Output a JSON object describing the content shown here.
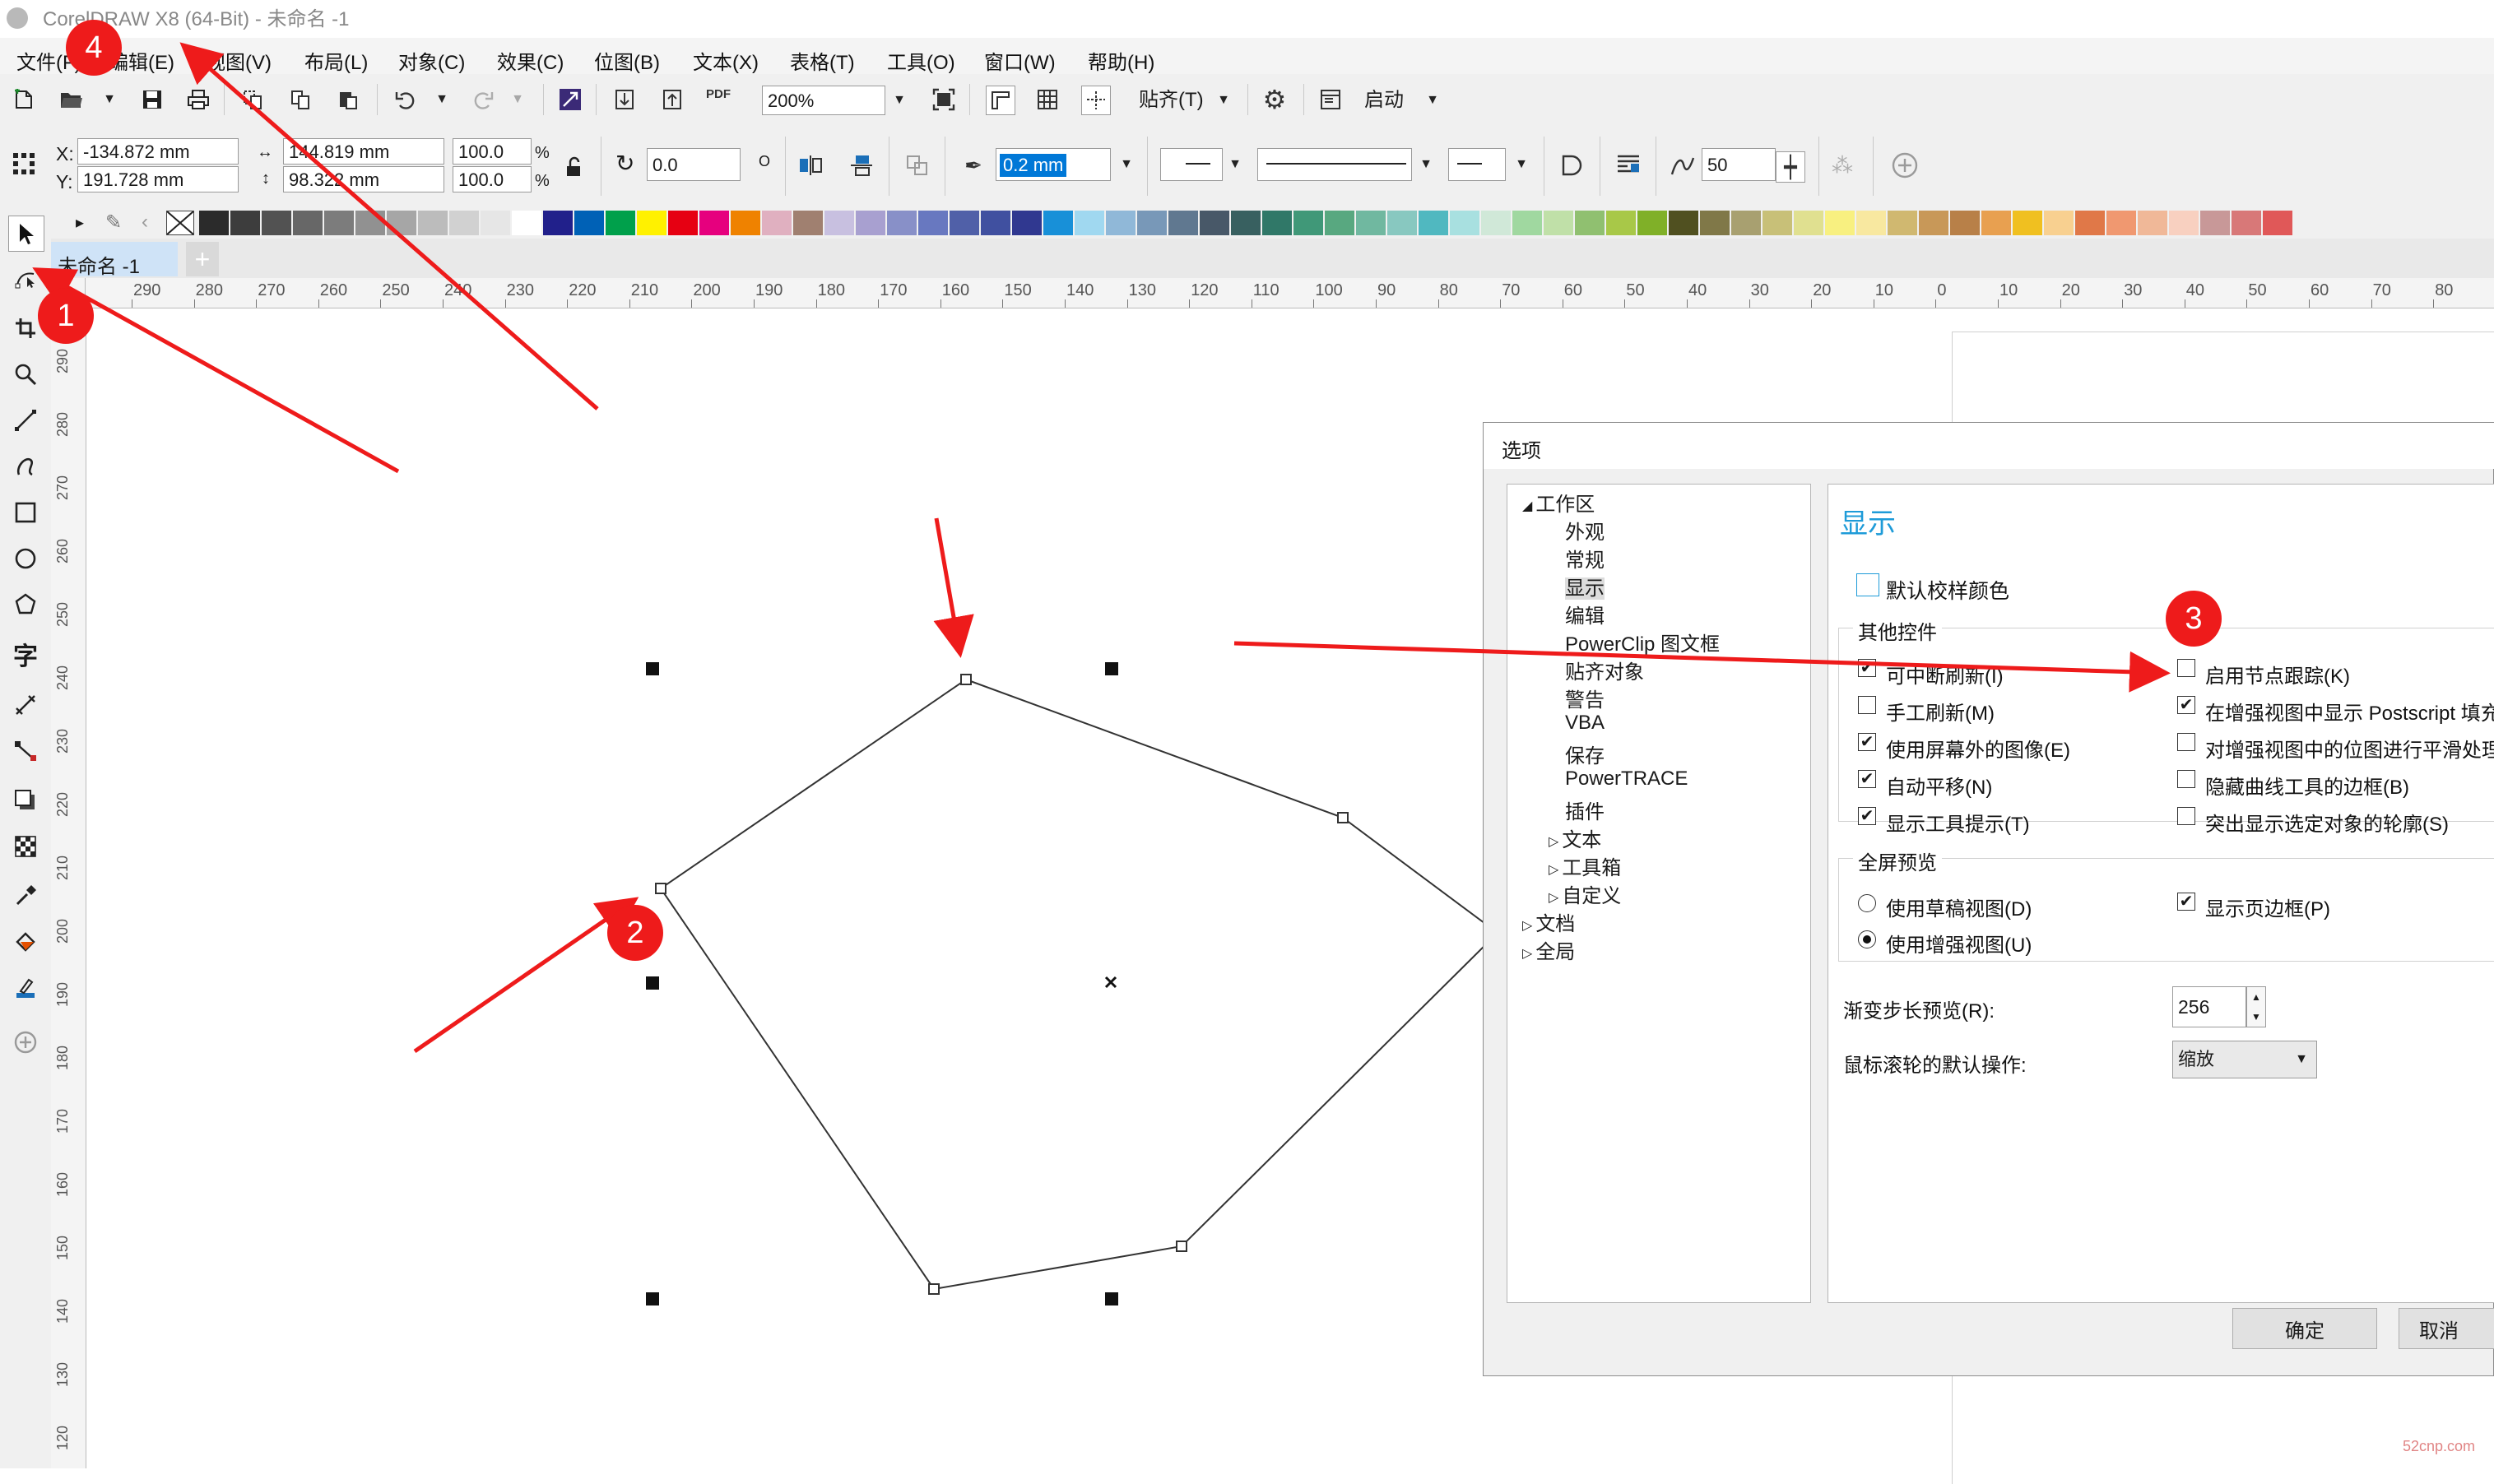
{
  "window": {
    "title": "CorelDRAW X8 (64-Bit) - 未命名 -1"
  },
  "menu": [
    "文件(F)",
    "编辑(E)",
    "视图(V)",
    "布局(L)",
    "对象(C)",
    "效果(C)",
    "位图(B)",
    "文本(X)",
    "表格(T)",
    "工具(O)",
    "窗口(W)",
    "帮助(H)"
  ],
  "toolbar": {
    "zoom": "200%",
    "snap_label": "贴齐(T)",
    "launch_label": "启动",
    "pdf_label": "PDF"
  },
  "properties": {
    "x_label": "X:",
    "x": "-134.872 mm",
    "y_label": "Y:",
    "y": "191.728 mm",
    "width": "144.819 mm",
    "height": "98.322 mm",
    "scale_w": "100.0",
    "scale_h": "100.0",
    "percent": "%",
    "rotation": "0.0",
    "degree": "O",
    "outline_width": "0.2 mm",
    "smoothing": "50"
  },
  "document_tab": "未命名 -1",
  "ruler": {
    "horizontal": [
      "290",
      "280",
      "270",
      "260",
      "250",
      "240",
      "230",
      "220",
      "210",
      "200",
      "190",
      "180",
      "170",
      "160",
      "150",
      "140",
      "130",
      "120",
      "110",
      "100",
      "90",
      "80",
      "70",
      "60",
      "50",
      "40",
      "30",
      "20",
      "10",
      "0",
      "10",
      "20",
      "30",
      "40",
      "50",
      "60",
      "70",
      "80"
    ],
    "vertical": [
      "290",
      "280",
      "270",
      "260",
      "250",
      "240",
      "230",
      "220",
      "210",
      "200",
      "190",
      "180",
      "170",
      "160",
      "150",
      "140",
      "130",
      "120"
    ]
  },
  "palette_colors": [
    "#2b2b2b",
    "#3d3d3d",
    "#525252",
    "#676767",
    "#7c7c7c",
    "#919191",
    "#a6a6a6",
    "#bcbcbc",
    "#d1d1d1",
    "#e6e6e6",
    "#ffffff",
    "#21208b",
    "#0061b6",
    "#00a04b",
    "#fff100",
    "#e60012",
    "#e6007e",
    "#ef8200",
    "#e0b0c0",
    "#a08070",
    "#c8c0e0",
    "#a8a0d0",
    "#8890c8",
    "#6878c0",
    "#5060a8",
    "#4050a0",
    "#303890",
    "#1890d8",
    "#a0d8f0",
    "#90b8d8",
    "#7898b8",
    "#607890",
    "#485868",
    "#386060",
    "#307868",
    "#409878",
    "#58a880",
    "#70b8a0",
    "#88c8c0",
    "#50b8c0",
    "#a8e0e0",
    "#d0e8d8",
    "#a0d8a0",
    "#c0e0a8",
    "#90c070",
    "#a8c848",
    "#80b028",
    "#505020",
    "#807848",
    "#a8a070",
    "#c8c078",
    "#e0e090",
    "#f8f080",
    "#f8e8a0",
    "#d0b870",
    "#c89858",
    "#b88048",
    "#e8a050",
    "#f0c020",
    "#f8d090",
    "#e07848",
    "#f09870",
    "#f0b898",
    "#f8d0c0",
    "#c89898",
    "#d87878",
    "#e05858"
  ],
  "dialog": {
    "title": "选项",
    "tree": [
      {
        "label": "工作区",
        "level": 0,
        "expanded": true
      },
      {
        "label": "外观",
        "level": 1
      },
      {
        "label": "常规",
        "level": 1
      },
      {
        "label": "显示",
        "level": 1,
        "selected": true
      },
      {
        "label": "编辑",
        "level": 1
      },
      {
        "label": "PowerClip 图文框",
        "level": 1
      },
      {
        "label": "贴齐对象",
        "level": 1
      },
      {
        "label": "警告",
        "level": 1
      },
      {
        "label": "VBA",
        "level": 1
      },
      {
        "label": "保存",
        "level": 1
      },
      {
        "label": "PowerTRACE",
        "level": 1
      },
      {
        "label": "插件",
        "level": 1
      },
      {
        "label": "文本",
        "level": 1,
        "collapsed": true
      },
      {
        "label": "工具箱",
        "level": 1,
        "collapsed": true
      },
      {
        "label": "自定义",
        "level": 1,
        "collapsed": true
      },
      {
        "label": "文档",
        "level": 0,
        "collapsed": true
      },
      {
        "label": "全局",
        "level": 0,
        "collapsed": true
      }
    ],
    "heading": "显示",
    "default_proof": {
      "label": "默认校样颜色",
      "checked": false
    },
    "group_other": "其他控件",
    "left_checks": [
      {
        "label": "可中断刷新(I)",
        "checked": true
      },
      {
        "label": "手工刷新(M)",
        "checked": false
      },
      {
        "label": "使用屏幕外的图像(E)",
        "checked": true
      },
      {
        "label": "自动平移(N)",
        "checked": true
      },
      {
        "label": "显示工具提示(T)",
        "checked": true
      }
    ],
    "right_checks": [
      {
        "label": "启用节点跟踪(K)",
        "checked": false
      },
      {
        "label": "在增强视图中显示 Postscript 填充",
        "checked": true
      },
      {
        "label": "对增强视图中的位图进行平滑处理",
        "checked": false
      },
      {
        "label": "隐藏曲线工具的边框(B)",
        "checked": false
      },
      {
        "label": "突出显示选定对象的轮廓(S)",
        "checked": false
      }
    ],
    "group_fullscreen": "全屏预览",
    "radios": [
      {
        "label": "使用草稿视图(D)",
        "selected": false
      },
      {
        "label": "使用增强视图(U)",
        "selected": true
      }
    ],
    "show_page_border": {
      "label": "显示页边框(P)",
      "checked": true
    },
    "fountain_label": "渐变步长预览(R):",
    "fountain_value": "256",
    "wheel_label": "鼠标滚轮的默认操作:",
    "wheel_value": "缩放",
    "ok": "确定",
    "cancel": "取消"
  },
  "annotations": [
    "1",
    "2",
    "3",
    "4"
  ],
  "annotation_color": "#ee1b1b",
  "watermark": "52cnp.com"
}
